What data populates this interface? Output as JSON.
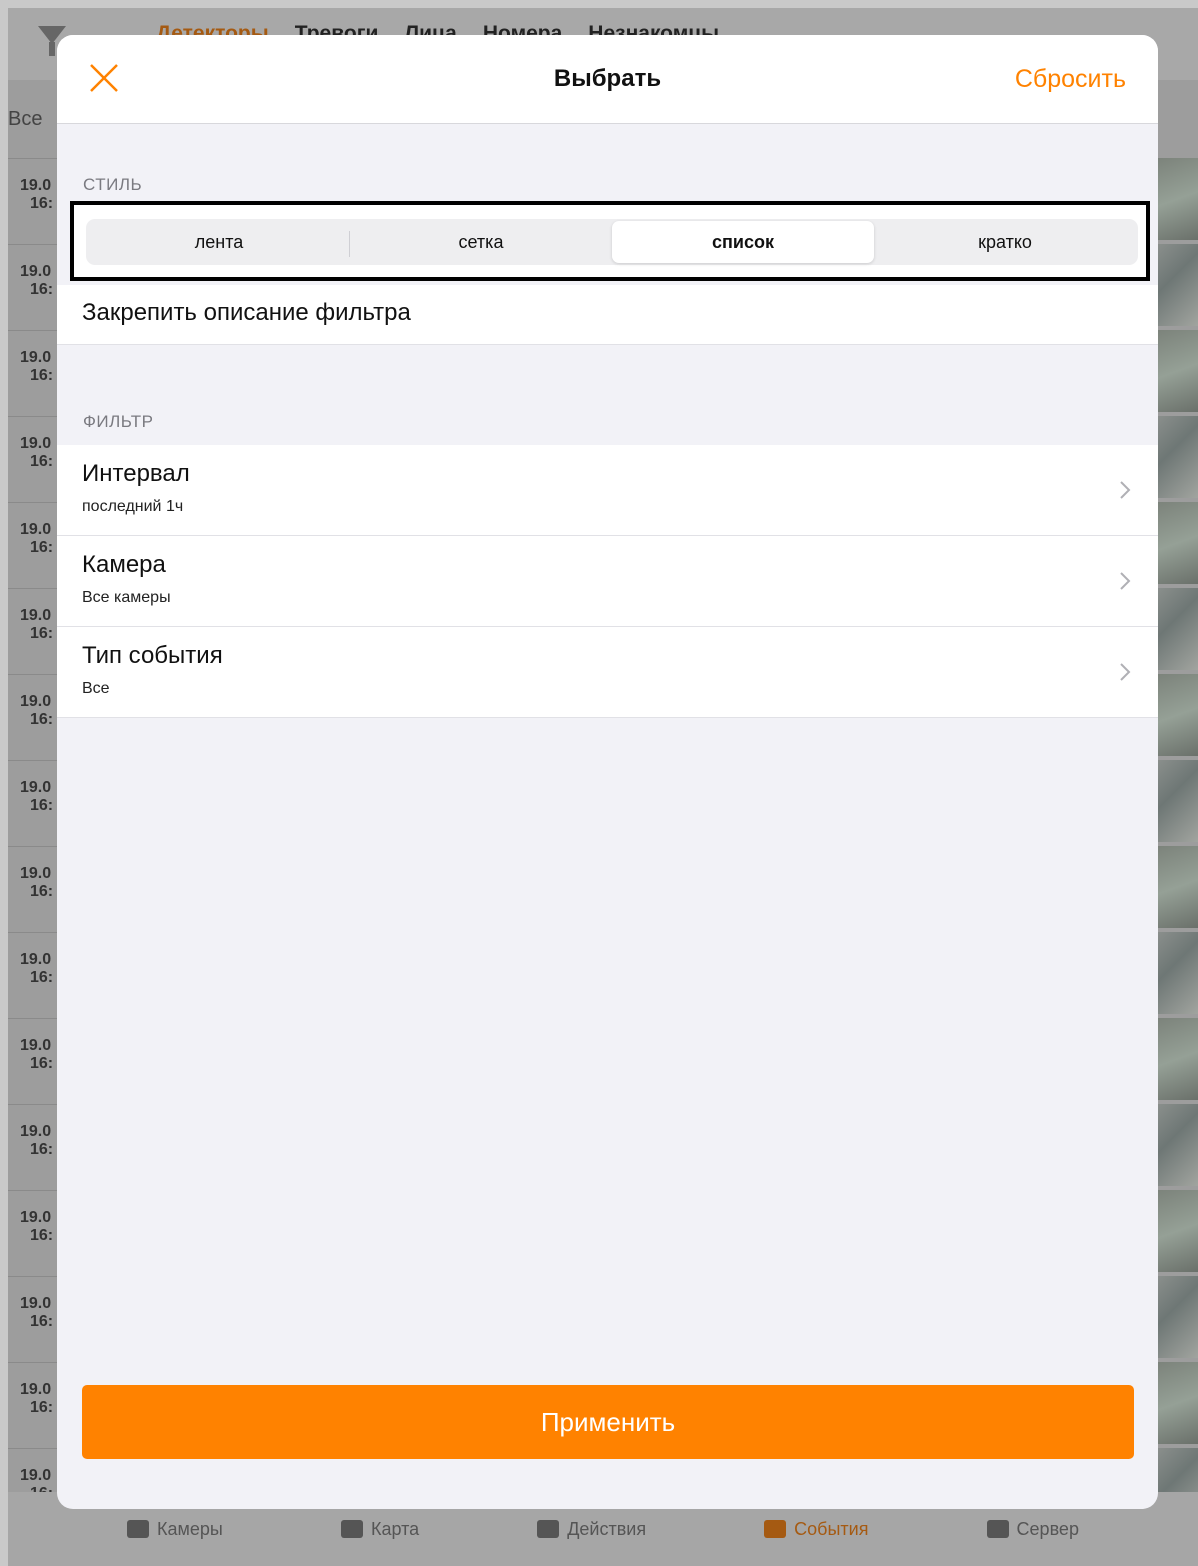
{
  "background": {
    "top_tabs": [
      "Детекторы",
      "Тревоги",
      "Лица",
      "Номера",
      "Незнакомцы"
    ],
    "all_label": "Все",
    "row_date": "19.0",
    "row_time": "16:",
    "bottom_nav": [
      "Камеры",
      "Карта",
      "Действия",
      "События",
      "Сервер"
    ]
  },
  "modal": {
    "title": "Выбрать",
    "reset_label": "Сбросить",
    "style_section_label": "СТИЛЬ",
    "style_options": [
      "лента",
      "сетка",
      "список",
      "кратко"
    ],
    "style_selected": "список",
    "pin_description_label": "Закрепить описание фильтра",
    "filter_section_label": "ФИЛЬТР",
    "filters": [
      {
        "title": "Интервал",
        "value": "последний 1ч"
      },
      {
        "title": "Камера",
        "value": "Все камеры"
      },
      {
        "title": "Тип события",
        "value": "Все"
      }
    ],
    "apply_label": "Применить"
  },
  "colors": {
    "accent": "#ff8200",
    "sheet_background": "#f2f2f7"
  }
}
